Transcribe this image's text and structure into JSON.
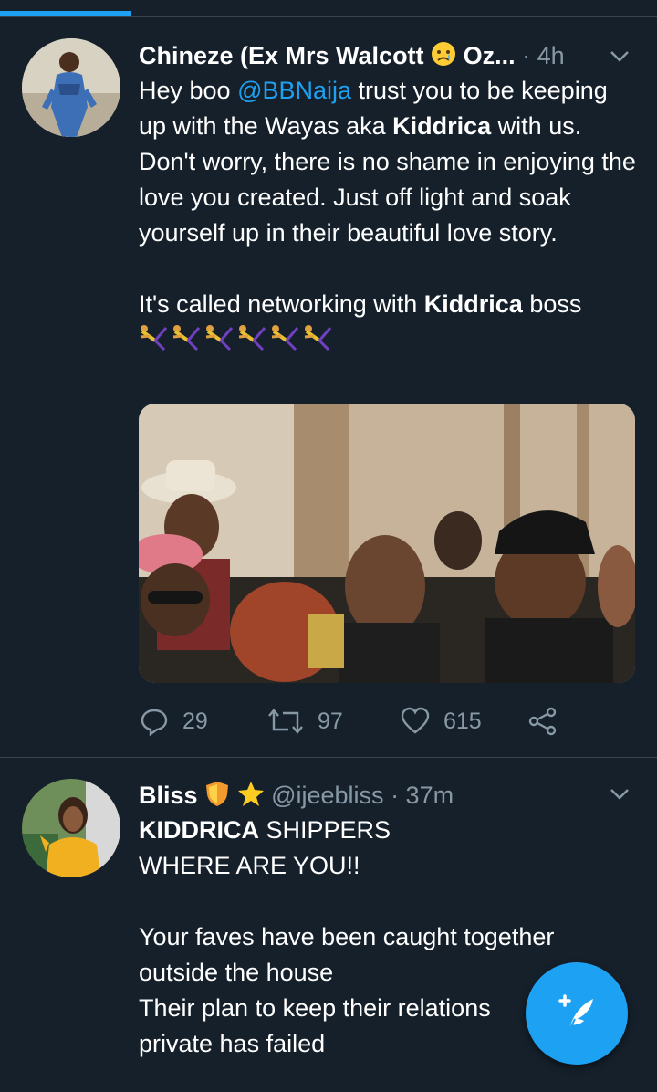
{
  "tweets": [
    {
      "author_name": "Chineze (Ex Mrs Walcott",
      "author_name_suffix": "Oz...",
      "time": "· 4h",
      "text_parts": {
        "a": "Hey boo ",
        "mention": "@BBNaija",
        "b": " trust you to be keeping up with the Wayas aka ",
        "bold1": "Kiddrica",
        "c": " with us. Don't worry, there is no shame in enjoying the love you created. Just off light and soak yourself up in their beautiful love story.",
        "d": "It's called networking with ",
        "bold2": "Kiddrica",
        "e": " boss"
      },
      "emoji_row": "cartwheel ×6",
      "actions": {
        "replies": "29",
        "retweets": "97",
        "likes": "615"
      }
    },
    {
      "author_name": "Bliss",
      "handle": "@ijeebliss",
      "time": "· 37m",
      "text_parts": {
        "bold": "KIDDRICA",
        "a": " SHIPPERS",
        "b": "WHERE ARE YOU!!",
        "c": "Your faves have been caught together outside the house",
        "d": "Their plan to keep their relations",
        "e": "private has failed"
      }
    }
  ],
  "icons": {
    "reply": "reply-icon",
    "retweet": "retweet-icon",
    "like": "heart-icon",
    "share": "share-icon",
    "caret": "chevron-down-icon",
    "compose": "compose-tweet-icon"
  },
  "colors": {
    "background": "#15202b",
    "accent": "#1da1f2",
    "secondary_text": "#8899a6",
    "divider": "#38444d"
  }
}
